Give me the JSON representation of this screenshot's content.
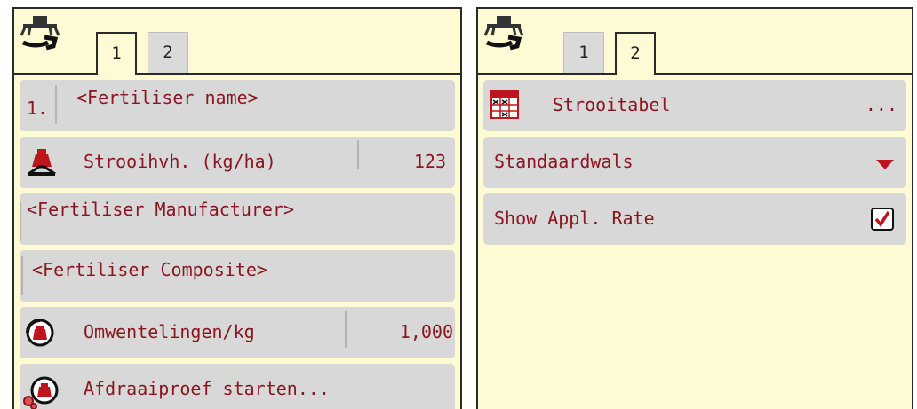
{
  "left_panel": {
    "tabs": [
      {
        "label": "1"
      },
      {
        "label": "2"
      }
    ],
    "active_tab": "1",
    "rows": {
      "fertiliser_index": "1.",
      "fertiliser_name": "<Fertiliser name>",
      "appl_rate_label": "Strooihvh. (kg/ha)",
      "appl_rate_value": "123",
      "manufacturer": "<Fertiliser Manufacturer>",
      "composite": "<Fertiliser Composite>",
      "rev_per_kg_label": "Omwentelingen/kg",
      "rev_per_kg_value": "1,000",
      "calibration_label": "Afdraaiproef starten..."
    }
  },
  "right_panel": {
    "tabs": [
      {
        "label": "1"
      },
      {
        "label": "2"
      }
    ],
    "active_tab": "2",
    "rows": {
      "spread_table_label": "Strooitabel",
      "spread_table_more": "...",
      "roller_value": "Standaardwals",
      "show_rate_label": "Show Appl. Rate",
      "show_rate_checked": true
    }
  },
  "icons": {
    "tab_header": "spreader-wrench-icon",
    "weight": "weight-scale-icon",
    "rotation": "rotation-weight-icon",
    "calibration": "gears-weight-icon",
    "table": "spread-table-icon",
    "dropdown": "red-triangle-down-icon",
    "checkbox": "checkbox-checked-icon"
  },
  "colors": {
    "panel_bg": "#fefbd4",
    "row_bg": "#d8d8d8",
    "text": "#8a1620",
    "accent": "#c0141c"
  }
}
